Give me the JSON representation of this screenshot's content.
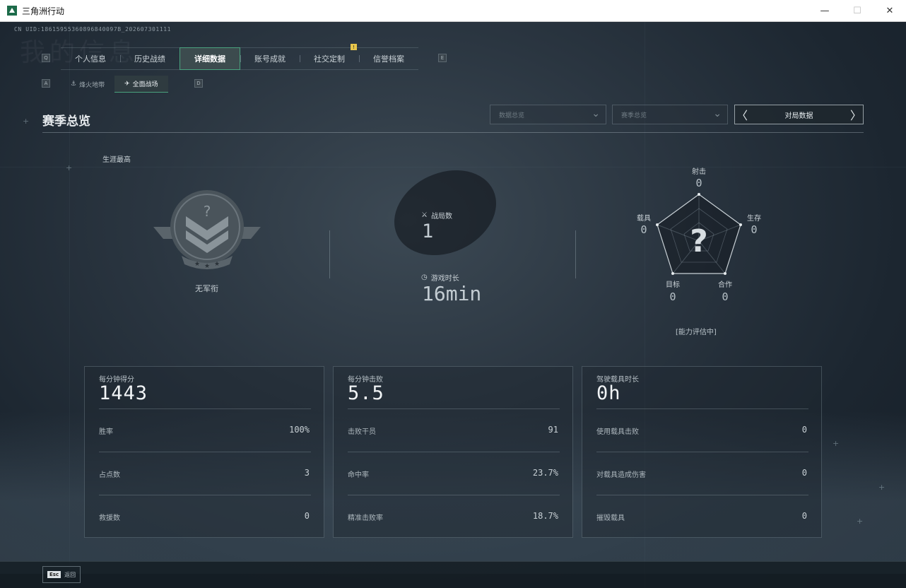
{
  "window": {
    "title": "三角洲行动",
    "minimize": "—",
    "maximize": "☐",
    "close": "✕"
  },
  "uid": "CN UID:18615955360896840097B_202607301111",
  "ghost_title": "我的信息",
  "key_hints": {
    "left": "Q",
    "right": "E",
    "sub_left": "A",
    "sub_right": "D"
  },
  "tabs": [
    {
      "label": "个人信息",
      "active": false
    },
    {
      "label": "历史战绩",
      "active": false
    },
    {
      "label": "详细数据",
      "active": true
    },
    {
      "label": "账号成就",
      "active": false
    },
    {
      "label": "社交定制",
      "active": false,
      "badge": "!"
    },
    {
      "label": "信誉档案",
      "active": false
    }
  ],
  "subtabs": [
    {
      "label": "烽火地带",
      "icon": "⚓",
      "active": false
    },
    {
      "label": "全面战场",
      "icon": "✈",
      "active": true
    }
  ],
  "section_title": "赛季总览",
  "filters": {
    "dropdown1": "数据总览",
    "dropdown2": "赛季总览",
    "pager_label": "对局数据",
    "prev": "〈",
    "next": "〉",
    "chevron": "⌄"
  },
  "career": {
    "label": "生涯最高",
    "rank_name": "无军衔",
    "rank_glyph": "?"
  },
  "middle": {
    "battles_label": "战局数",
    "battles_value": "1",
    "playtime_label": "游戏时长",
    "playtime_value": "16min"
  },
  "radar": {
    "center_glyph": "?",
    "axes": [
      {
        "label": "射击",
        "value": "0"
      },
      {
        "label": "生存",
        "value": "0"
      },
      {
        "label": "合作",
        "value": "0"
      },
      {
        "label": "目标",
        "value": "0"
      },
      {
        "label": "载具",
        "value": "0"
      }
    ],
    "note": "[能力评估中]"
  },
  "cards": [
    {
      "label": "每分钟得分",
      "value": "1443",
      "rows": [
        {
          "label": "胜率",
          "value": "100%"
        },
        {
          "label": "占点数",
          "value": "3"
        },
        {
          "label": "救援数",
          "value": "0"
        }
      ]
    },
    {
      "label": "每分钟击败",
      "value": "5.5",
      "rows": [
        {
          "label": "击败干员",
          "value": "91"
        },
        {
          "label": "命中率",
          "value": "23.7%"
        },
        {
          "label": "精准击败率",
          "value": "18.7%"
        }
      ]
    },
    {
      "label": "驾驶载具时长",
      "value": "0h",
      "rows": [
        {
          "label": "使用载具击败",
          "value": "0"
        },
        {
          "label": "对载具造成伤害",
          "value": "0"
        },
        {
          "label": "摧毁载具",
          "value": "0"
        }
      ]
    }
  ],
  "bottom": {
    "esc_key": "Esc",
    "esc_label": "返回"
  },
  "colors": {
    "accent": "#4aa27e",
    "badge": "#e8c64b",
    "background": "#1c2630"
  }
}
